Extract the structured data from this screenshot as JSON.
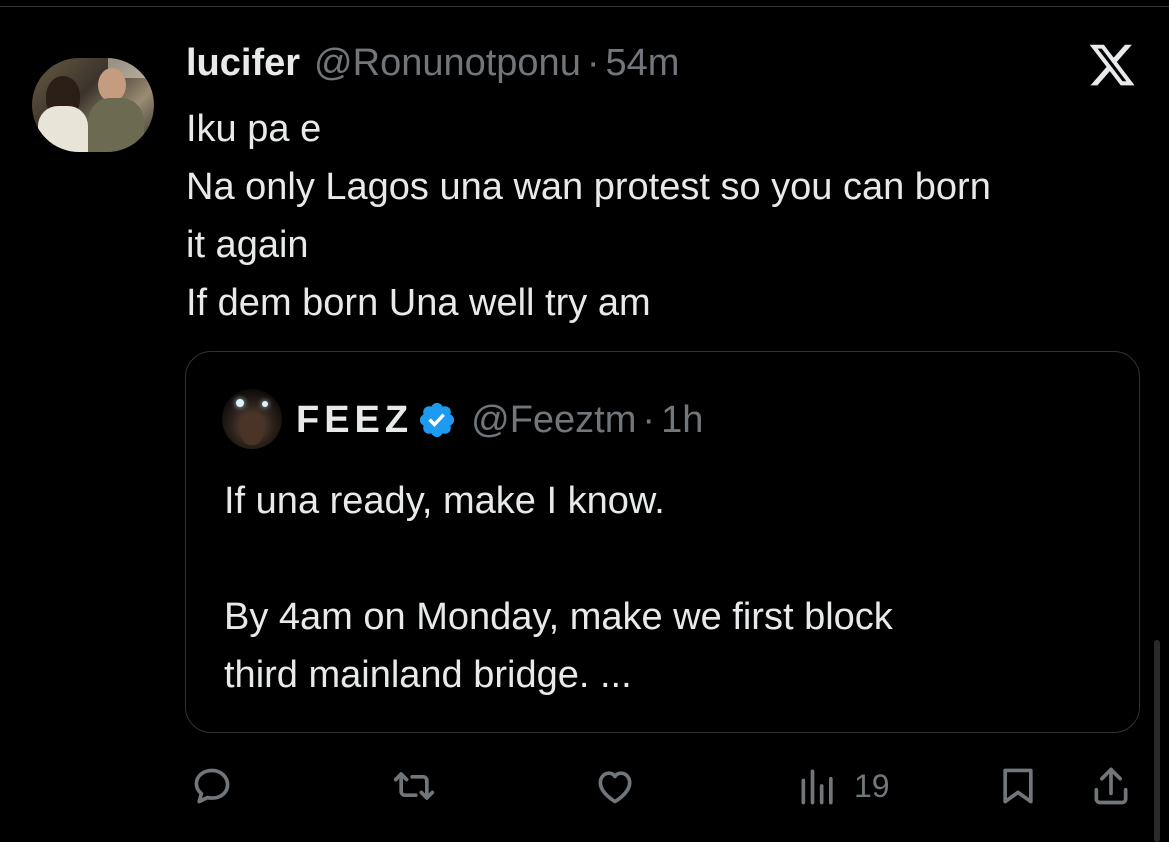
{
  "tweet": {
    "display_name": "lucifer",
    "handle": "@Ronunotponu",
    "separator": "·",
    "time": "54m",
    "text_lines": [
      "Iku pa e",
      "Na only Lagos una wan protest so you can born",
      "it again",
      "If dem born Una well try am"
    ]
  },
  "quote": {
    "display_name": "FEEZ",
    "handle": "@Feeztm",
    "separator": "·",
    "time": "1h",
    "text_lines": [
      "If una ready, make I know.",
      "",
      "By 4am on Monday, make we first block",
      "third mainland bridge. ..."
    ]
  },
  "actions": {
    "reply_icon": "reply-icon",
    "retweet_icon": "retweet-icon",
    "like_icon": "heart-icon",
    "views_icon": "views-icon",
    "views_count": "19",
    "bookmark_icon": "bookmark-icon",
    "share_icon": "share-icon"
  },
  "colors": {
    "background": "#000000",
    "text_primary": "#e7e9ea",
    "text_secondary": "#71767b",
    "border": "#2f3336",
    "verified_blue": "#1d9bf0"
  }
}
